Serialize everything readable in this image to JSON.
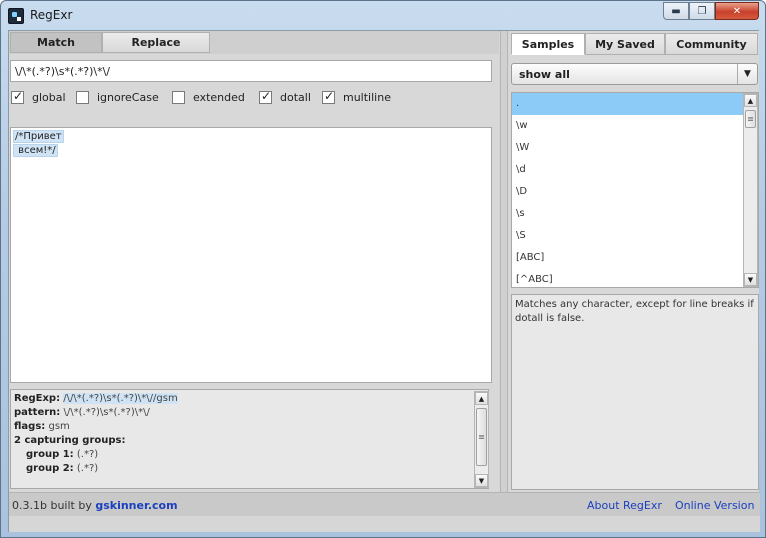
{
  "window": {
    "title": "RegExr",
    "minimize_glyph": "▬",
    "maximize_glyph": "❐",
    "close_glyph": "✕"
  },
  "left_tabs": {
    "match": "Match",
    "replace": "Replace"
  },
  "regex": {
    "value": "\\/\\*(.*?)\\s*(.*?)\\*\\/"
  },
  "flags": [
    {
      "label": "global",
      "checked": true
    },
    {
      "label": "ignoreCase",
      "checked": false
    },
    {
      "label": "extended",
      "checked": false
    },
    {
      "label": "dotall",
      "checked": true
    },
    {
      "label": "multiline",
      "checked": true
    }
  ],
  "source_text": {
    "line1": "/*Привет",
    "line2": " всем!*/"
  },
  "info": {
    "regexp_label": "RegExp:",
    "regexp_value": "/\\/\\*(.*?)\\s*(.*?)\\*\\//gsm",
    "pattern_label": "pattern:",
    "pattern_value": "\\/\\*(.*?)\\s*(.*?)\\*\\/",
    "flags_label": "flags:",
    "flags_value": "gsm",
    "groups_label": "2 capturing groups:",
    "group1_label": "group 1:",
    "group1_value": "(.*?)",
    "group2_label": "group 2:",
    "group2_value": "(.*?)"
  },
  "status": {
    "version": "0.3.1b built by ",
    "author_link": "gskinner.com",
    "about": "About RegExr",
    "online": "Online Version"
  },
  "right_tabs": {
    "samples": "Samples",
    "my_saved": "My Saved",
    "community": "Community"
  },
  "dropdown": {
    "selected": "show all",
    "arrow": "▼"
  },
  "samples": [
    ".",
    "\\w",
    "\\W",
    "\\d",
    "\\D",
    "\\s",
    "\\S",
    "[ABC]",
    "[^ABC]"
  ],
  "selected_sample_index": 0,
  "description": "Matches any character, except for line breaks if dotall is false.",
  "scroll_glyphs": {
    "up": "▲",
    "down": "▼"
  },
  "colors": {
    "selection": "#8ccbf7",
    "match_highlight": "#cfe3f5",
    "link": "#1a3fbf"
  }
}
